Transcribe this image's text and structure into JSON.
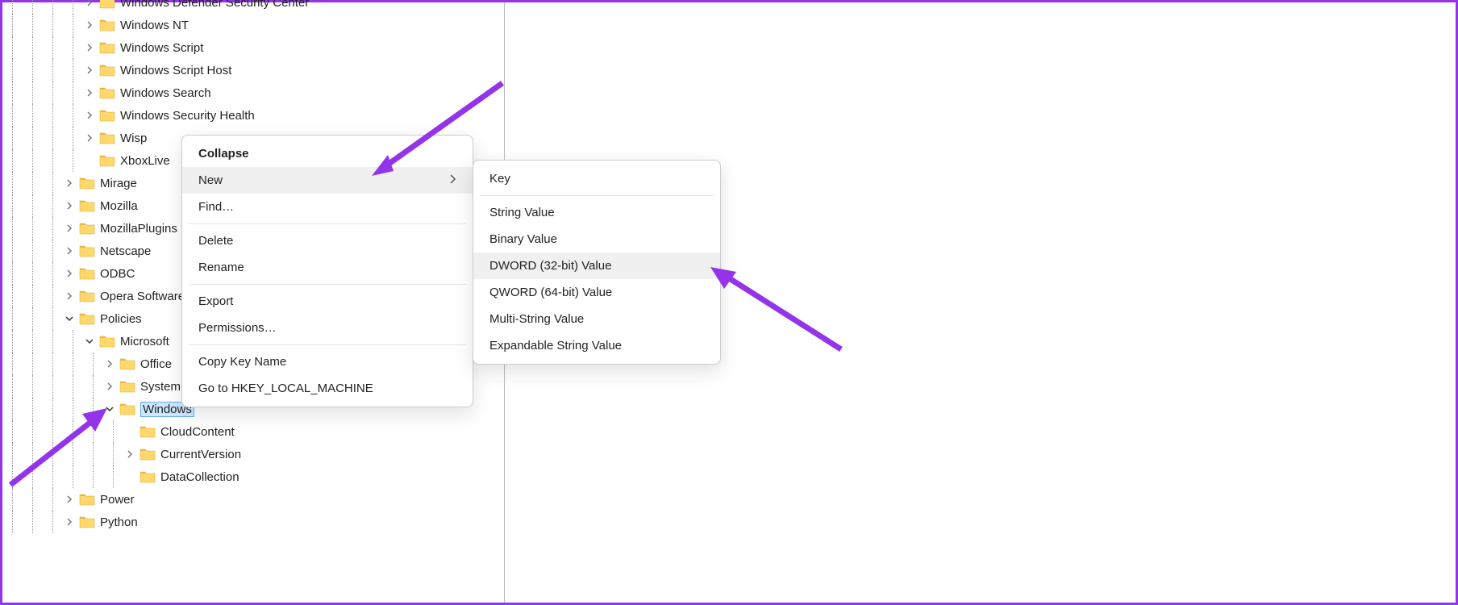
{
  "tree": [
    {
      "indent": 4,
      "label": "Windows Defender Security Center",
      "chevron": "right",
      "cut": true
    },
    {
      "indent": 4,
      "label": "Windows NT",
      "chevron": "right"
    },
    {
      "indent": 4,
      "label": "Windows Script",
      "chevron": "right"
    },
    {
      "indent": 4,
      "label": "Windows Script Host",
      "chevron": "right"
    },
    {
      "indent": 4,
      "label": "Windows Search",
      "chevron": "right"
    },
    {
      "indent": 4,
      "label": "Windows Security Health",
      "chevron": "right"
    },
    {
      "indent": 4,
      "label": "Wisp",
      "chevron": "right"
    },
    {
      "indent": 4,
      "label": "XboxLive",
      "chevron": "none"
    },
    {
      "indent": 3,
      "label": "Mirage",
      "chevron": "right"
    },
    {
      "indent": 3,
      "label": "Mozilla",
      "chevron": "right"
    },
    {
      "indent": 3,
      "label": "MozillaPlugins",
      "chevron": "right"
    },
    {
      "indent": 3,
      "label": "Netscape",
      "chevron": "right"
    },
    {
      "indent": 3,
      "label": "ODBC",
      "chevron": "right"
    },
    {
      "indent": 3,
      "label": "Opera Software",
      "chevron": "right"
    },
    {
      "indent": 3,
      "label": "Policies",
      "chevron": "down"
    },
    {
      "indent": 4,
      "label": "Microsoft",
      "chevron": "down"
    },
    {
      "indent": 5,
      "label": "Office",
      "chevron": "right"
    },
    {
      "indent": 5,
      "label": "SystemCertificates",
      "chevron": "right"
    },
    {
      "indent": 5,
      "label": "Windows",
      "chevron": "down",
      "selected": true
    },
    {
      "indent": 6,
      "label": "CloudContent",
      "chevron": "none"
    },
    {
      "indent": 6,
      "label": "CurrentVersion",
      "chevron": "right"
    },
    {
      "indent": 6,
      "label": "DataCollection",
      "chevron": "none"
    },
    {
      "indent": 3,
      "label": "Power",
      "chevron": "right"
    },
    {
      "indent": 3,
      "label": "Python",
      "chevron": "right"
    }
  ],
  "contextMenu": {
    "collapse": "Collapse",
    "new": "New",
    "find": "Find…",
    "delete": "Delete",
    "rename": "Rename",
    "export": "Export",
    "permissions": "Permissions…",
    "copyKeyName": "Copy Key Name",
    "goto": "Go to HKEY_LOCAL_MACHINE"
  },
  "submenu": {
    "key": "Key",
    "stringValue": "String Value",
    "binaryValue": "Binary Value",
    "dword": "DWORD (32-bit) Value",
    "qword": "QWORD (64-bit) Value",
    "multiString": "Multi-String Value",
    "expandString": "Expandable String Value"
  }
}
